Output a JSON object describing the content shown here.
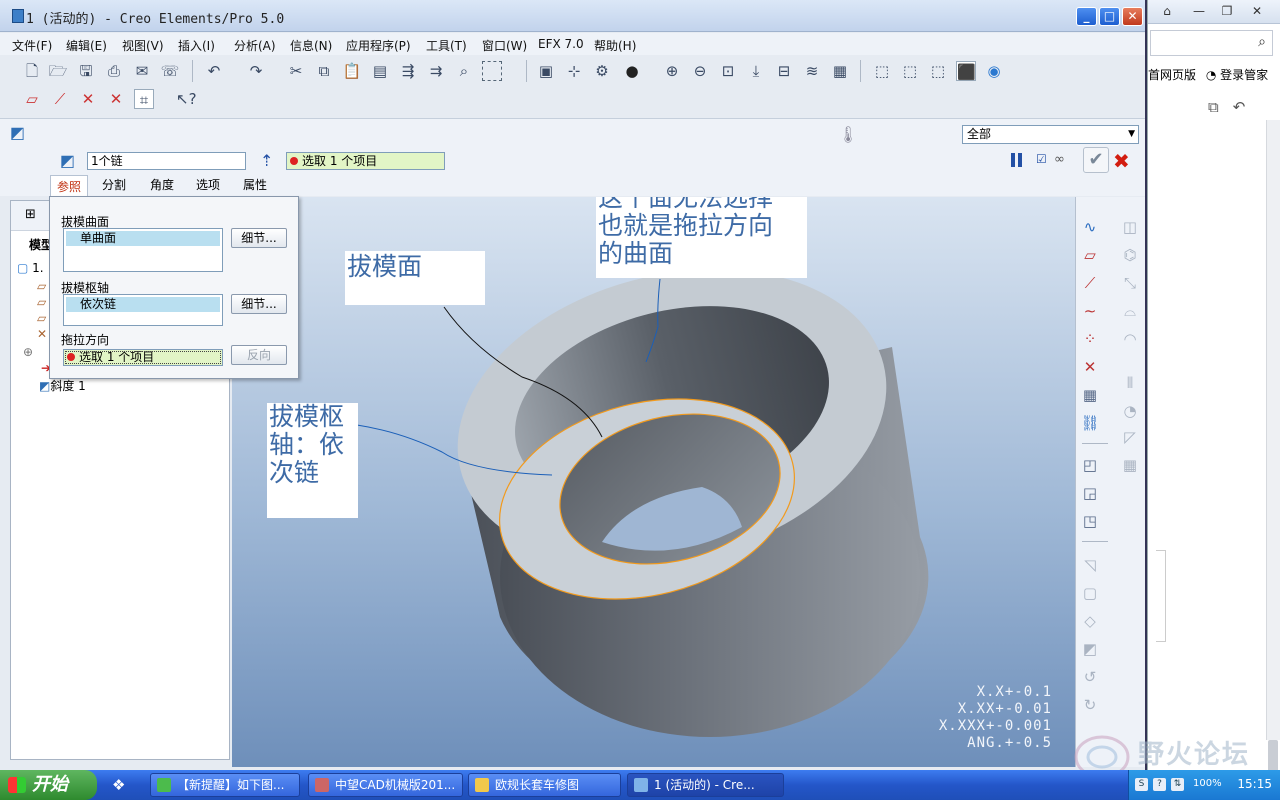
{
  "window": {
    "title": "1 (活动的) - Creo Elements/Pro 5.0",
    "badge": "50",
    "buttons": {
      "minimize": "_",
      "maximize": "□",
      "close": "✕"
    }
  },
  "menu": [
    "文件(F)",
    "编辑(E)",
    "视图(V)",
    "插入(I)",
    "分析(A)",
    "信息(N)",
    "应用程序(P)",
    "工具(T)",
    "窗口(W)",
    "EFX 7.0",
    "帮助(H)"
  ],
  "dashboard": {
    "chain_field": "1个链",
    "select_field": "选取 1 个项目",
    "filter": "全部",
    "tabs": [
      "参照",
      "分割",
      "角度",
      "选项",
      "属性"
    ],
    "active_tab": "参照"
  },
  "ref_panel": {
    "draft_surface_label": "拔模曲面",
    "draft_surface_item": "单曲面",
    "detail_button": "细节...",
    "hinge_label": "拔模枢轴",
    "hinge_item": "依次链",
    "direction_label": "拖拉方向",
    "direction_item": "选取 1 个项目",
    "reverse_button": "反向"
  },
  "tree": {
    "header": "模型",
    "root": "1.",
    "last_item": "斜度 1"
  },
  "annotations": {
    "draft_face": "拔模面",
    "cannot_select": "这个面无法选择\n也就是拖拉方向\n的曲面",
    "hinge": "拔模枢\n轴：依\n次链"
  },
  "tolerance": [
    "X.X+-0.1",
    "X.XX+-0.01",
    "X.XXX+-0.001",
    "ANG.+-0.5"
  ],
  "background_window": {
    "links": "首网页版",
    "login": "登录管家"
  },
  "watermark": "野火论坛",
  "taskbar": {
    "start": "开始",
    "tasks": [
      "【新提醒】如下图...",
      "中望CAD机械版201...",
      "欧规长套车修图",
      "1 (活动的) - Cre..."
    ],
    "tray_percent": "100%",
    "clock": "15:15"
  },
  "colors": {
    "annotation_text": "#3e6ba6",
    "selected_edge": "#f29a1c",
    "cancel": "#d21d10",
    "selection_green": "#e2f5c6"
  }
}
